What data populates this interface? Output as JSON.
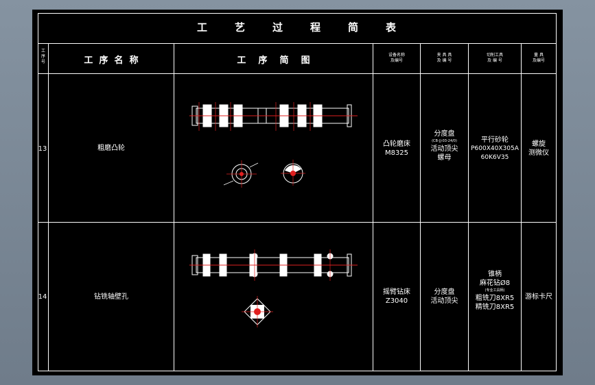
{
  "title_chars": [
    "工",
    "艺",
    "过",
    "程",
    "简",
    "表"
  ],
  "headers": {
    "seq": [
      "工",
      "序",
      "号"
    ],
    "name": "工  序  名  称",
    "diagram": "工    序    简    图",
    "equipment": [
      "设备名称",
      "及编号"
    ],
    "fixture": [
      "夹 具 具",
      "及 编 号"
    ],
    "tool": [
      "切削工具",
      "及 编 号"
    ],
    "gauge": [
      "量  具",
      "及编号"
    ]
  },
  "rows": [
    {
      "seq": "13",
      "name": "粗磨凸轮",
      "equipment": [
        "凸轮磨床",
        "M8325"
      ],
      "fixture": [
        "分度盘",
        "(CB-JJ-03-24/0)",
        "活动顶尖",
        "螺母"
      ],
      "tool": [
        "平行砂轮",
        "P600X40X305A",
        "60K6V35"
      ],
      "gauge": [
        "螺旋",
        "测微仪"
      ]
    },
    {
      "seq": "14",
      "name": "钻铣轴壁孔",
      "equipment": [
        "摇臂钻床",
        "Z3040"
      ],
      "fixture": [
        "分度盘",
        "活动顶尖"
      ],
      "tool": [
        "锥柄",
        "麻花钻Ø8",
        "(专业工具柄)",
        "粗铣刀8XR5",
        "精铣刀8XR5"
      ],
      "gauge": [
        "游标卡尺"
      ]
    }
  ]
}
